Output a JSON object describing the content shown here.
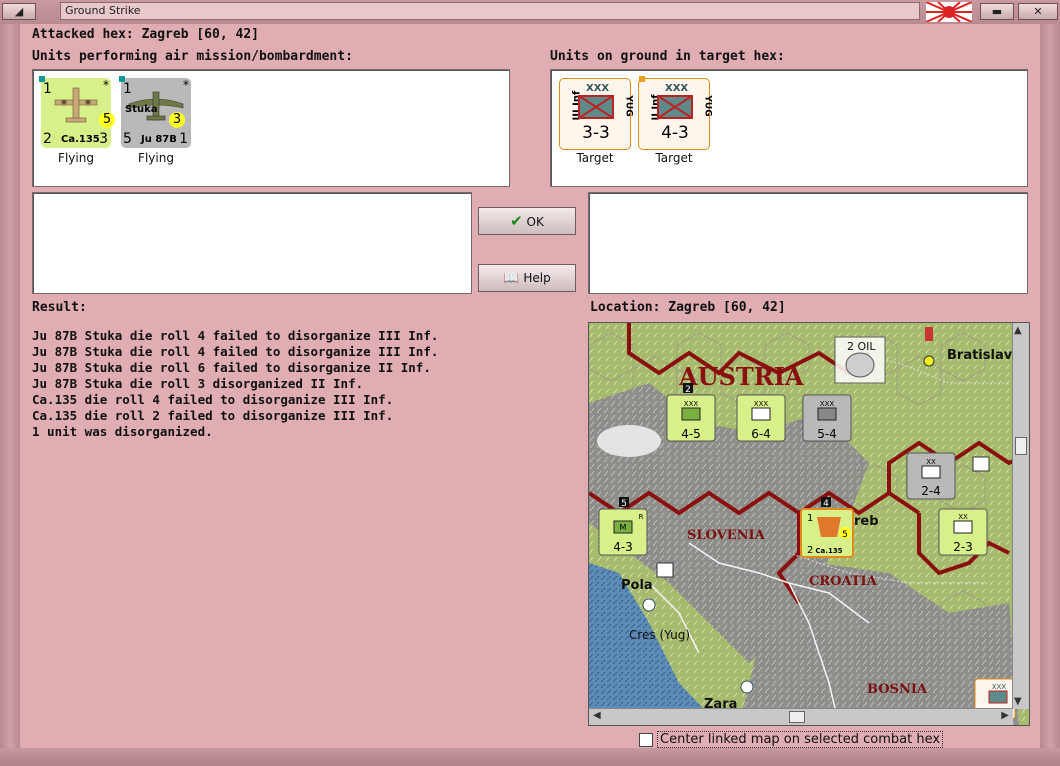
{
  "window": {
    "title": "Ground Strike"
  },
  "header": {
    "attacked_hex": "Attacked hex: Zagreb  [60, 42]"
  },
  "air_units": {
    "label": "Units performing air mission/bombardment:",
    "units": [
      {
        "name": "Ca.135",
        "top_left": "1",
        "star": "*",
        "bottom_left": "2",
        "bottom_right": "3",
        "circle": "5",
        "status": "Flying",
        "bg": "#d8f08a"
      },
      {
        "name": "Ju 87B",
        "subname": "Stuka",
        "top_left": "1",
        "star": "*",
        "bottom_left": "5",
        "bottom_right": "1",
        "circle": "3",
        "status": "Flying",
        "bg": "#b9b9b9"
      }
    ]
  },
  "ground_units": {
    "label": "Units on ground in target hex:",
    "units": [
      {
        "side": "III Inf",
        "nation": "YUG",
        "size": "XXX",
        "strength": "3-3",
        "status": "Target"
      },
      {
        "side": "II Inf",
        "nation": "YUG",
        "size": "XXX",
        "strength": "4-3",
        "status": "Target"
      }
    ]
  },
  "buttons": {
    "ok": "OK",
    "help": "Help"
  },
  "result": {
    "label": "Result:",
    "lines": [
      "Ju 87B Stuka die roll 4 failed to disorganize III Inf.",
      "Ju 87B Stuka die roll 4 failed to disorganize III Inf.",
      "Ju 87B Stuka die roll 6 failed to disorganize II Inf.",
      "Ju 87B Stuka die roll 3 disorganized II Inf.",
      "Ca.135 die roll 4 failed to disorganize III Inf.",
      "Ca.135 die roll 2 failed to disorganize III Inf.",
      "1 unit was disorganized."
    ]
  },
  "location": {
    "label": "Location:  Zagreb  [60, 42]",
    "map_labels": {
      "austria": "AUSTRIA",
      "slovenia": "SLOVENIA",
      "croatia": "CROATIA",
      "bosnia": "BOSNIA",
      "bratislava": "Bratislav",
      "pola": "Pola",
      "cres": "Cres (Yug)",
      "zara": "Zara",
      "oil": "2 OIL",
      "zagreb_partial": "reb"
    },
    "map_counters": [
      {
        "size": "XXX",
        "strength": "4-5",
        "stack": "2"
      },
      {
        "size": "XXX",
        "strength": "6-4"
      },
      {
        "size": "XXX",
        "strength": "5-4"
      },
      {
        "size": "XX",
        "strength": "2-4"
      },
      {
        "size": "M",
        "strength": "4-3",
        "stack": "5",
        "corner": "R"
      },
      {
        "size": "XX",
        "strength": "2-3"
      },
      {
        "size": "",
        "strength": "Ca.135",
        "stack": "4",
        "top_left": "1",
        "bottom_left": "2",
        "circle": "5"
      },
      {
        "size": "XXX",
        "strength": ""
      }
    ]
  },
  "footer": {
    "checkbox_label": "Center linked map on selected combat hex"
  },
  "colors": {
    "dialog_bg": "#dfadb2",
    "hex_border": "#8a1010",
    "counter_orange_border": "#e08a1a",
    "target_counter_bg": "#fff6ee"
  }
}
